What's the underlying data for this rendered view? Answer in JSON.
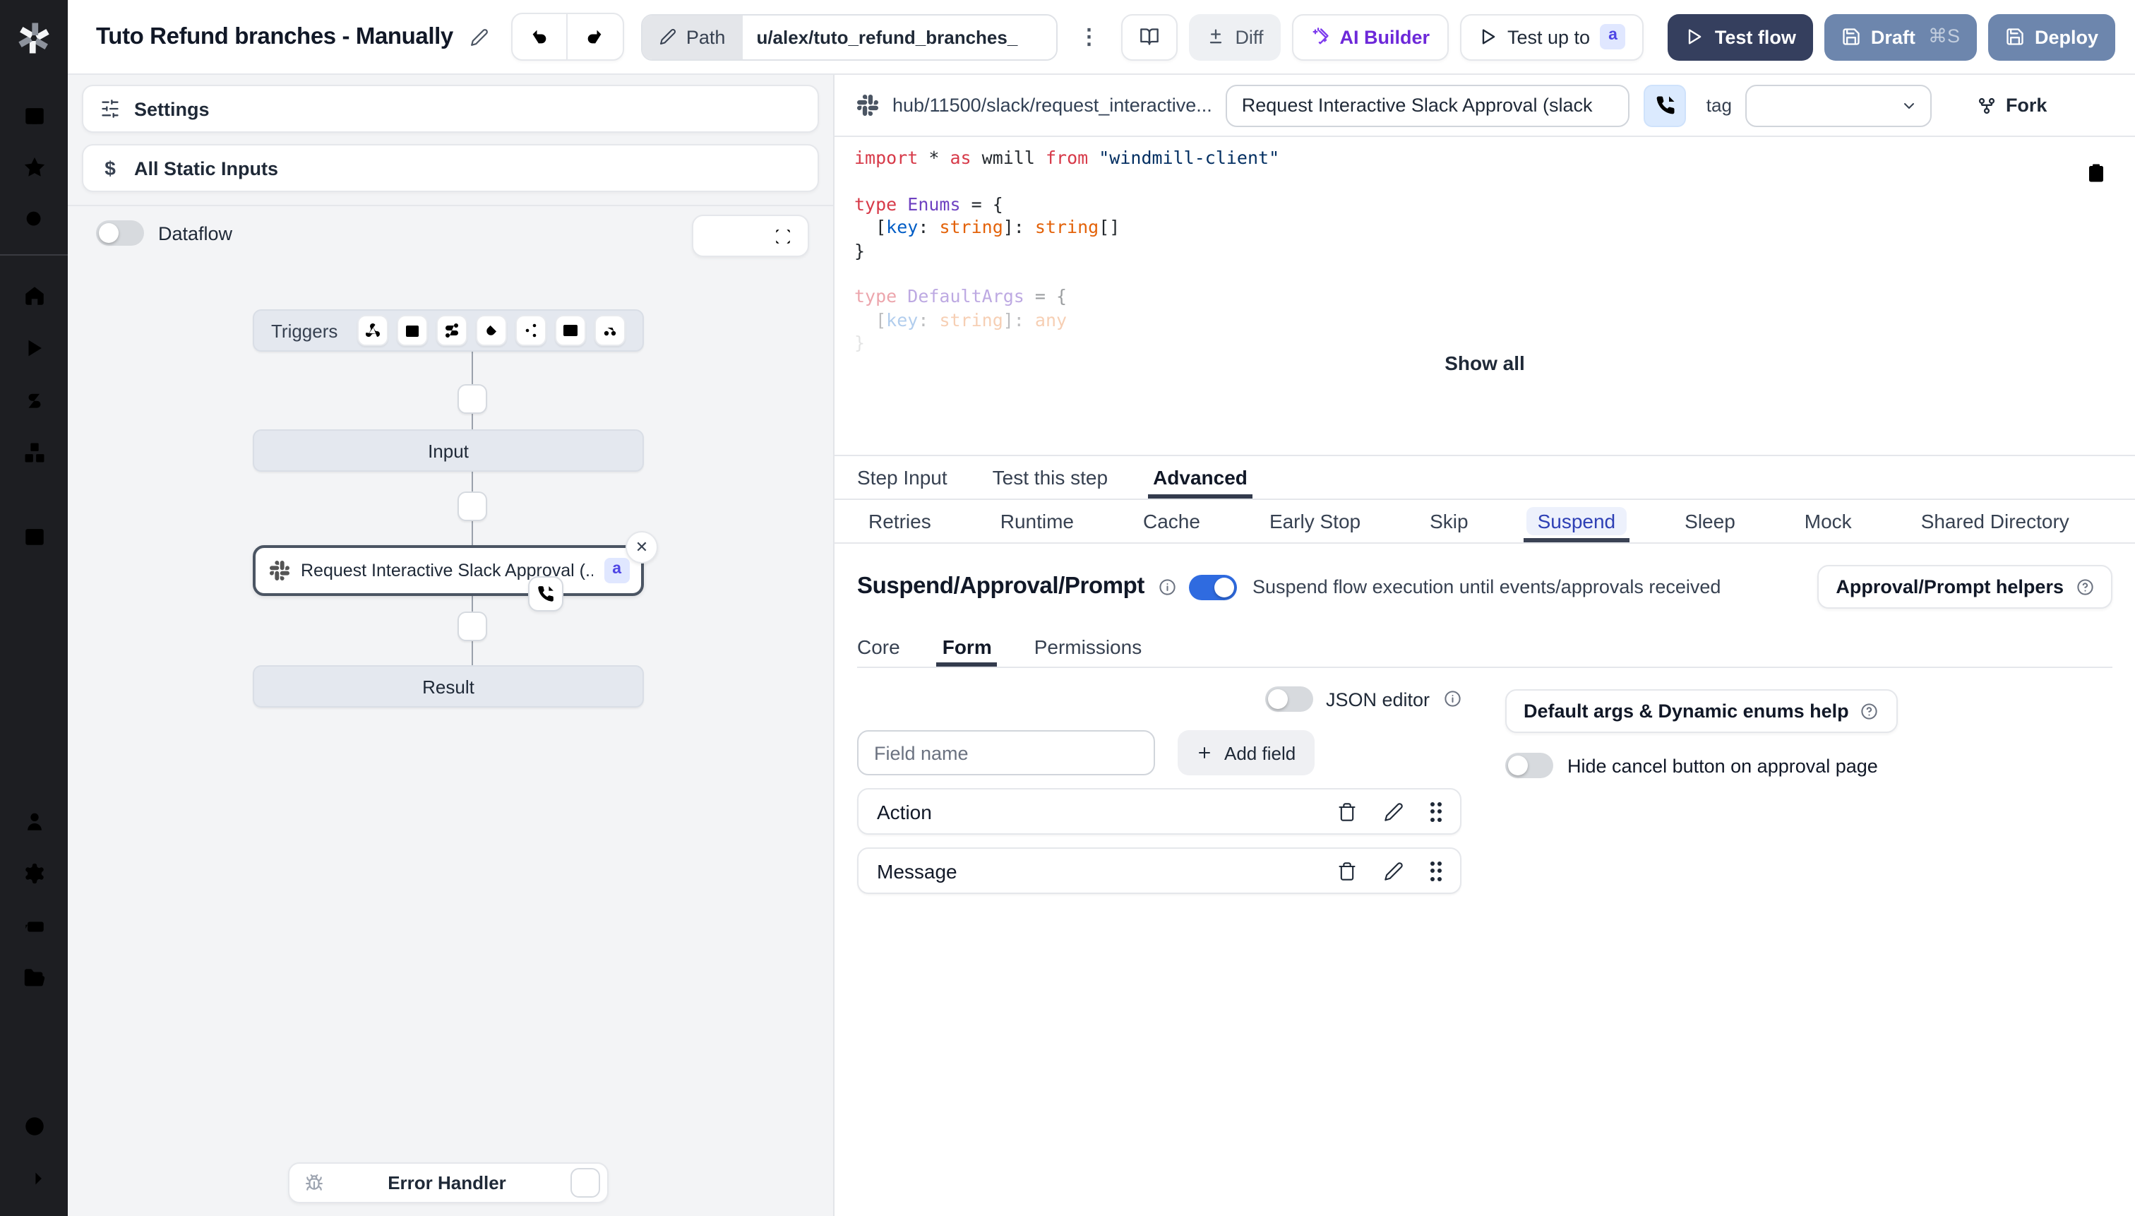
{
  "topbar": {
    "title": "Tuto Refund branches - Manually",
    "path_label": "Path",
    "path_value": "u/alex/tuto_refund_branches_",
    "diff_label": "Diff",
    "ai_builder_label": "AI Builder",
    "test_up_to_label": "Test up to",
    "test_up_to_badge": "a",
    "test_flow_label": "Test flow",
    "draft_label": "Draft",
    "draft_shortcut": "⌘S",
    "deploy_label": "Deploy"
  },
  "sidebar": {
    "icons": [
      "windmill-logo",
      "building",
      "star",
      "search",
      "home",
      "runs-play",
      "variables-dollar",
      "resources-cubes",
      "schedules-calendar",
      "add-plus",
      "users-person",
      "settings-gear",
      "workers-robot",
      "folders",
      "audit-logs-list",
      "help-circle",
      "collapse-arrow-right"
    ]
  },
  "left_panel": {
    "settings_label": "Settings",
    "static_inputs_label": "All Static Inputs",
    "dataflow_label": "Dataflow",
    "graph": {
      "triggers_label": "Triggers",
      "trigger_icons": [
        "webhook",
        "schedule",
        "http-route",
        "websocket",
        "kafka",
        "email",
        "scheduled-poll"
      ],
      "input_label": "Input",
      "step_title": "Request Interactive Slack Approval (...",
      "step_badge": "a",
      "result_label": "Result",
      "error_handler_label": "Error Handler"
    }
  },
  "right_panel": {
    "header": {
      "hub_path": "hub/11500/slack/request_interactive...",
      "name_value": "Request Interactive Slack Approval (slack",
      "tag_label": "tag",
      "fork_label": "Fork"
    },
    "code": {
      "show_all": "Show all",
      "lines": [
        {
          "fade": 1,
          "tokens": [
            [
              "import",
              "kw"
            ],
            [
              " * ",
              "pl"
            ],
            [
              "as",
              "kw"
            ],
            [
              " wmill ",
              "pl"
            ],
            [
              "from",
              "kw"
            ],
            [
              " ",
              "pl"
            ],
            [
              "\"windmill-client\"",
              "str"
            ]
          ]
        },
        {
          "fade": 1,
          "tokens": []
        },
        {
          "fade": 1,
          "tokens": [
            [
              "type",
              "kw"
            ],
            [
              " ",
              "pl"
            ],
            [
              "Enums",
              "ty"
            ],
            [
              " = {",
              "pl"
            ]
          ]
        },
        {
          "fade": 1,
          "tokens": [
            [
              "  [",
              "pl"
            ],
            [
              "key",
              "pr"
            ],
            [
              ": ",
              "pl"
            ],
            [
              "string",
              "or"
            ],
            [
              "]: ",
              "pl"
            ],
            [
              "string",
              "or"
            ],
            [
              "[]",
              "pl"
            ]
          ]
        },
        {
          "fade": 1,
          "tokens": [
            [
              "}",
              "pl"
            ]
          ]
        },
        {
          "fade": 1,
          "tokens": []
        },
        {
          "fade": 0.45,
          "tokens": [
            [
              "type",
              "kw"
            ],
            [
              " ",
              "pl"
            ],
            [
              "DefaultArgs",
              "ty"
            ],
            [
              " = {",
              "pl"
            ]
          ]
        },
        {
          "fade": 0.3,
          "tokens": [
            [
              "  [",
              "pl"
            ],
            [
              "key",
              "pr"
            ],
            [
              ": ",
              "pl"
            ],
            [
              "string",
              "or"
            ],
            [
              "]: ",
              "pl"
            ],
            [
              "any",
              "or"
            ]
          ]
        },
        {
          "fade": 0.12,
          "tokens": [
            [
              "}",
              "pl"
            ]
          ]
        }
      ]
    },
    "tabs": [
      "Step Input",
      "Test this step",
      "Advanced"
    ],
    "active_tab": "Advanced",
    "subtabs": [
      "Retries",
      "Runtime",
      "Cache",
      "Early Stop",
      "Skip",
      "Suspend",
      "Sleep",
      "Mock",
      "Shared Directory"
    ],
    "active_subtab": "Suspend",
    "suspend": {
      "title": "Suspend/Approval/Prompt",
      "toggle_description": "Suspend flow execution until events/approvals received",
      "helpers_button": "Approval/Prompt helpers",
      "form_tabs": [
        "Core",
        "Form",
        "Permissions"
      ],
      "active_form_tab": "Form",
      "json_editor_label": "JSON editor",
      "field_name_placeholder": "Field name",
      "add_field_label": "Add field",
      "fields": [
        "Action",
        "Message"
      ],
      "default_args_button": "Default args & Dynamic enums help",
      "hide_cancel_label": "Hide cancel button on approval page"
    }
  },
  "colors": {
    "toggle_on_blue": "#2f6be0",
    "badge_bg": "#e0e7ff",
    "badge_text": "#4f46e5",
    "test_flow_bg": "#353f5e",
    "draft_deploy_bg": "#6d86ad",
    "active_subtab_text": "#2e40b5",
    "sidebar_bg": "#1d1e22",
    "canvas_bg": "#f3f4f6"
  }
}
